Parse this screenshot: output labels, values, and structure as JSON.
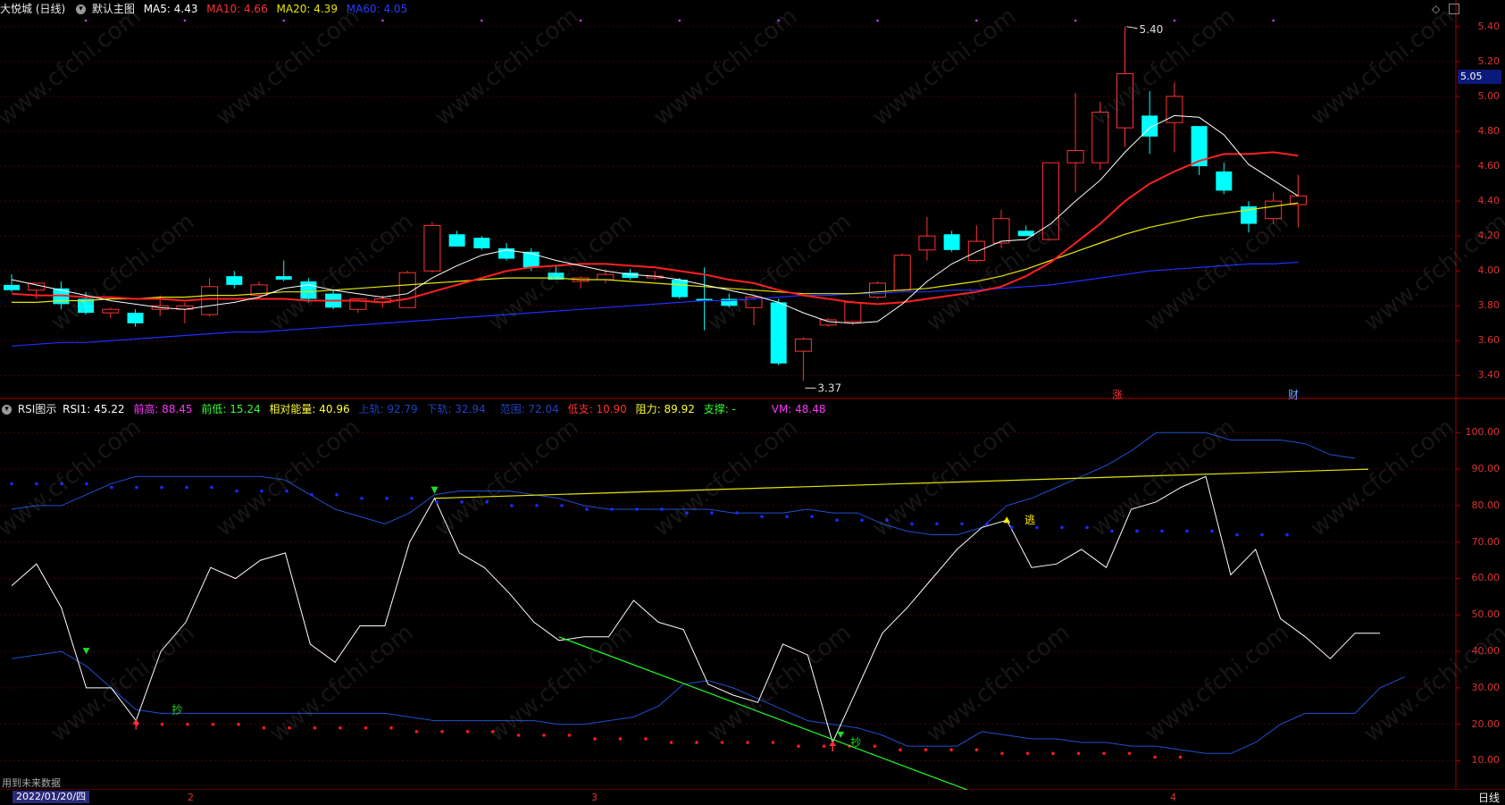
{
  "main_header": {
    "stock": "大悦城 (日线)",
    "panel": "默认主图",
    "ma5": "MA5: 4.43",
    "ma10": "MA10: 4.66",
    "ma20": "MA20: 4.39",
    "ma60": "MA60: 4.05"
  },
  "rsi_header": {
    "panel": "RSI图示",
    "rsi1": "RSI1: 45.22",
    "prev_high": "前高: 88.45",
    "prev_low": "前低: 15.24",
    "rel_energy": "相对能量: 40.96",
    "upper": "上轨: 92.79",
    "lower": "下轨: 32.94",
    "range": "范围: 72.04",
    "low_support": "低支: 10.90",
    "resistance": "阻力: 89.92",
    "support": "支撑: -",
    "vm": "VM: 48.48"
  },
  "footer": {
    "future_note": "用到未来数据",
    "date": "2022/01/20/四",
    "period": "日线",
    "x_ticks": [
      "2",
      "3",
      "4"
    ]
  },
  "last_price": "5.05",
  "markers": {
    "high_label": "5.40",
    "low_label": "3.37",
    "zhang": "涨",
    "cai": "财",
    "chao": "抄",
    "tao": "逃"
  },
  "colors": {
    "up": "#ff3333",
    "down": "#00ffff",
    "ma5": "#ffffff",
    "ma10": "#ff2020",
    "ma20": "#e6e600",
    "ma60": "#2030ff",
    "rsi": "#ffffff",
    "band": "#2050d0"
  },
  "chart_data": [
    {
      "type": "candlestick",
      "title": "大悦城 (日线)",
      "y_axis": [
        3.4,
        3.6,
        3.8,
        4.0,
        4.2,
        4.4,
        4.6,
        4.8,
        5.0,
        5.2,
        5.4
      ],
      "ylim": [
        3.3,
        5.45
      ],
      "ohlc": [
        [
          3.92,
          3.98,
          3.88,
          3.89
        ],
        [
          3.89,
          3.93,
          3.84,
          3.93
        ],
        [
          3.9,
          3.94,
          3.78,
          3.81
        ],
        [
          3.84,
          3.88,
          3.75,
          3.76
        ],
        [
          3.76,
          3.79,
          3.73,
          3.78
        ],
        [
          3.76,
          3.78,
          3.68,
          3.7
        ],
        [
          3.78,
          3.86,
          3.74,
          3.8
        ],
        [
          3.78,
          3.82,
          3.7,
          3.8
        ],
        [
          3.75,
          3.96,
          3.74,
          3.91
        ],
        [
          3.97,
          4.0,
          3.9,
          3.92
        ],
        [
          3.86,
          3.94,
          3.84,
          3.92
        ],
        [
          3.97,
          4.06,
          3.94,
          3.95
        ],
        [
          3.94,
          3.96,
          3.82,
          3.84
        ],
        [
          3.87,
          3.89,
          3.78,
          3.79
        ],
        [
          3.78,
          3.84,
          3.76,
          3.84
        ],
        [
          3.82,
          3.86,
          3.79,
          3.84
        ],
        [
          3.79,
          4.0,
          3.79,
          3.99
        ],
        [
          4.0,
          4.28,
          3.99,
          4.26
        ],
        [
          4.21,
          4.23,
          4.14,
          4.14
        ],
        [
          4.19,
          4.2,
          4.12,
          4.13
        ],
        [
          4.13,
          4.16,
          4.06,
          4.07
        ],
        [
          4.11,
          4.13,
          4.0,
          4.02
        ],
        [
          3.99,
          4.03,
          3.97,
          3.95
        ],
        [
          3.94,
          3.97,
          3.9,
          3.96
        ],
        [
          3.95,
          4.01,
          3.93,
          3.98
        ],
        [
          3.99,
          4.01,
          3.95,
          3.96
        ],
        [
          3.96,
          4.0,
          3.95,
          3.97
        ],
        [
          3.95,
          3.96,
          3.84,
          3.85
        ],
        [
          3.84,
          4.02,
          3.66,
          3.83
        ],
        [
          3.84,
          3.87,
          3.79,
          3.8
        ],
        [
          3.79,
          3.86,
          3.69,
          3.85
        ],
        [
          3.82,
          3.84,
          3.46,
          3.47
        ],
        [
          3.54,
          3.62,
          3.37,
          3.61
        ],
        [
          3.69,
          3.73,
          3.68,
          3.72
        ],
        [
          3.71,
          3.83,
          3.69,
          3.82
        ],
        [
          3.85,
          3.94,
          3.84,
          3.93
        ],
        [
          3.89,
          4.1,
          3.88,
          4.09
        ],
        [
          4.12,
          4.31,
          4.06,
          4.2
        ],
        [
          4.21,
          4.23,
          4.11,
          4.12
        ],
        [
          4.06,
          4.26,
          4.05,
          4.17
        ],
        [
          4.16,
          4.35,
          4.13,
          4.3
        ],
        [
          4.23,
          4.26,
          4.21,
          4.2
        ],
        [
          4.18,
          4.62,
          4.18,
          4.62
        ],
        [
          4.62,
          5.02,
          4.45,
          4.69
        ],
        [
          4.62,
          4.97,
          4.58,
          4.91
        ],
        [
          4.82,
          5.4,
          4.71,
          5.13
        ],
        [
          4.89,
          5.03,
          4.67,
          4.77
        ],
        [
          4.85,
          5.08,
          4.68,
          5.0
        ],
        [
          4.83,
          4.83,
          4.55,
          4.6
        ],
        [
          4.57,
          4.62,
          4.44,
          4.46
        ],
        [
          4.37,
          4.4,
          4.22,
          4.27
        ],
        [
          4.3,
          4.45,
          4.27,
          4.4
        ],
        [
          4.38,
          4.55,
          4.25,
          4.43
        ]
      ],
      "ma5": [
        3.95,
        3.92,
        3.89,
        3.86,
        3.83,
        3.81,
        3.79,
        3.78,
        3.8,
        3.82,
        3.85,
        3.9,
        3.92,
        3.89,
        3.87,
        3.85,
        3.87,
        3.96,
        4.03,
        4.09,
        4.12,
        4.1,
        4.06,
        4.03,
        4.0,
        3.98,
        3.97,
        3.95,
        3.92,
        3.89,
        3.86,
        3.82,
        3.76,
        3.71,
        3.7,
        3.71,
        3.81,
        3.94,
        4.04,
        4.11,
        4.17,
        4.18,
        4.27,
        4.4,
        4.52,
        4.68,
        4.82,
        4.89,
        4.88,
        4.78,
        4.61,
        4.52,
        4.43
      ],
      "ma10": [
        3.87,
        3.86,
        3.86,
        3.85,
        3.85,
        3.84,
        3.84,
        3.83,
        3.84,
        3.84,
        3.84,
        3.84,
        3.83,
        3.83,
        3.83,
        3.82,
        3.84,
        3.88,
        3.92,
        3.96,
        4.0,
        4.02,
        4.03,
        4.04,
        4.04,
        4.03,
        4.02,
        4.0,
        3.98,
        3.95,
        3.93,
        3.89,
        3.86,
        3.84,
        3.82,
        3.81,
        3.82,
        3.84,
        3.86,
        3.88,
        3.91,
        3.97,
        4.05,
        4.16,
        4.27,
        4.4,
        4.5,
        4.57,
        4.63,
        4.67,
        4.67,
        4.68,
        4.66
      ],
      "ma20": [
        3.82,
        3.82,
        3.83,
        3.83,
        3.84,
        3.84,
        3.85,
        3.85,
        3.86,
        3.86,
        3.87,
        3.88,
        3.88,
        3.89,
        3.9,
        3.91,
        3.92,
        3.93,
        3.94,
        3.95,
        3.96,
        3.96,
        3.96,
        3.95,
        3.95,
        3.94,
        3.93,
        3.92,
        3.91,
        3.9,
        3.89,
        3.88,
        3.87,
        3.87,
        3.87,
        3.88,
        3.89,
        3.9,
        3.92,
        3.94,
        3.97,
        4.01,
        4.06,
        4.11,
        4.16,
        4.21,
        4.25,
        4.28,
        4.31,
        4.33,
        4.35,
        4.37,
        4.39
      ],
      "ma60": [
        3.57,
        3.58,
        3.59,
        3.59,
        3.6,
        3.61,
        3.62,
        3.63,
        3.64,
        3.65,
        3.65,
        3.66,
        3.67,
        3.68,
        3.69,
        3.7,
        3.71,
        3.72,
        3.73,
        3.74,
        3.75,
        3.76,
        3.77,
        3.78,
        3.79,
        3.8,
        3.81,
        3.82,
        3.83,
        3.83,
        3.84,
        3.85,
        3.86,
        3.86,
        3.87,
        3.87,
        3.88,
        3.88,
        3.89,
        3.89,
        3.9,
        3.91,
        3.92,
        3.94,
        3.96,
        3.98,
        4.0,
        4.01,
        4.02,
        4.03,
        4.04,
        4.04,
        4.05
      ]
    },
    {
      "type": "line",
      "title": "RSI图示",
      "y_axis": [
        10,
        20,
        30,
        40,
        50,
        60,
        70,
        80,
        90,
        100
      ],
      "ylim": [
        3,
        104
      ],
      "rsi": [
        58,
        64,
        52,
        30,
        30,
        21,
        40,
        48,
        63,
        60,
        65,
        67,
        42,
        37,
        47,
        47,
        70,
        82,
        67,
        63,
        56,
        48,
        43,
        44,
        44,
        54,
        48,
        46,
        31,
        28,
        26,
        42,
        39,
        15,
        30,
        45,
        52,
        60,
        68,
        74,
        76,
        63,
        64,
        68,
        63,
        79,
        81,
        85,
        88,
        61,
        68,
        49,
        44,
        38,
        45,
        45
      ],
      "upper_band": [
        79,
        80,
        80,
        83,
        86,
        88,
        88,
        88,
        88,
        88,
        88,
        87,
        83,
        79,
        77,
        75,
        78,
        83,
        84,
        84,
        84,
        83,
        82,
        80,
        79,
        79,
        79,
        79,
        79,
        78,
        78,
        78,
        79,
        78,
        78,
        75,
        73,
        72,
        72,
        74,
        80,
        82,
        85,
        88,
        91,
        95,
        100,
        100,
        100,
        98,
        98,
        98,
        97,
        94,
        93
      ],
      "lower_band": [
        38,
        39,
        40,
        36,
        30,
        24,
        23,
        23,
        23,
        23,
        23,
        23,
        23,
        23,
        23,
        23,
        22,
        21,
        21,
        21,
        21,
        21,
        20,
        20,
        21,
        22,
        25,
        31,
        32,
        30,
        27,
        24,
        21,
        20,
        19,
        17,
        14,
        14,
        14,
        18,
        17,
        16,
        16,
        15,
        15,
        14,
        14,
        13,
        12,
        12,
        15,
        20,
        23,
        23,
        23,
        30,
        33
      ],
      "blue_dots": [
        86,
        86,
        86,
        86,
        85,
        85,
        85,
        85,
        85,
        84,
        84,
        84,
        83,
        83,
        82,
        82,
        82,
        81,
        81,
        81,
        80,
        80,
        80,
        79,
        79,
        79,
        79,
        78,
        78,
        78,
        77,
        77,
        77,
        76,
        76,
        76,
        75,
        75,
        75,
        75,
        74,
        74,
        74,
        74,
        73,
        73,
        73,
        73,
        73,
        72,
        72,
        72
      ],
      "red_dots": [
        20,
        20,
        20,
        20,
        20,
        19,
        19,
        19,
        19,
        19,
        19,
        18,
        18,
        18,
        18,
        17,
        17,
        17,
        16,
        16,
        16,
        15,
        15,
        15,
        15,
        15,
        14,
        14,
        14,
        14,
        13,
        13,
        13,
        13,
        12,
        12,
        12,
        12,
        12,
        12,
        11,
        11
      ]
    }
  ]
}
